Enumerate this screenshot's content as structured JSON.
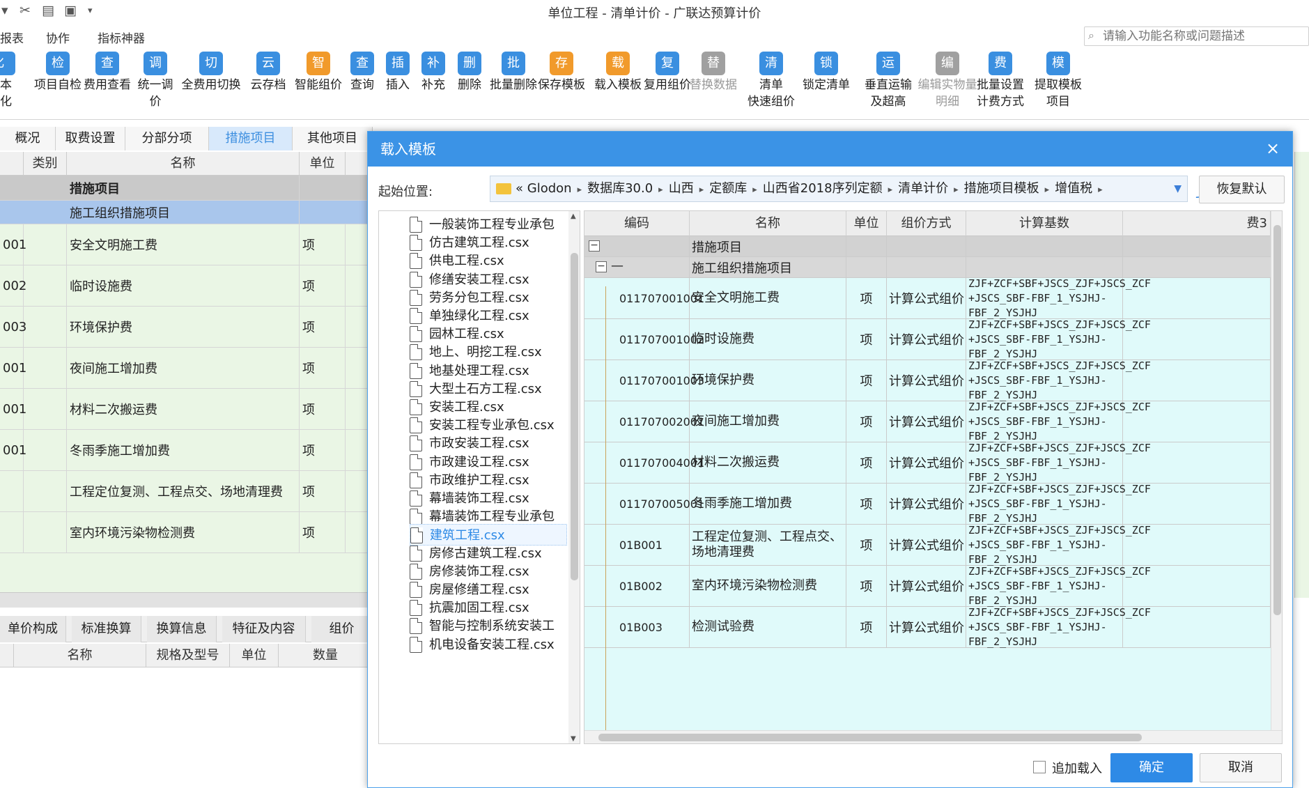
{
  "app": {
    "title": "单位工程 - 清单计价 - 广联达预算计价",
    "quick_access": [
      "▾",
      "✂",
      "▤",
      "▣",
      "▾"
    ]
  },
  "menu": [
    "报表",
    "协作",
    "指标神器"
  ],
  "search": {
    "placeholder": "请输入功能名称或问题描述"
  },
  "ribbon": [
    {
      "label": "本化",
      "icon": "partial-icon",
      "color": "#3a8fe0"
    },
    {
      "label": "项目自检",
      "icon": "check-icon",
      "color": "#3a8fe0"
    },
    {
      "label": "费用查看",
      "icon": "fee-view-icon",
      "color": "#3a8fe0"
    },
    {
      "label": "统一调价",
      "icon": "adjust-price-icon",
      "color": "#3a8fe0"
    },
    {
      "label": "全费用切换",
      "icon": "switch-icon",
      "color": "#3a8fe0"
    },
    {
      "label": "云存档",
      "icon": "cloud-icon",
      "color": "#3a8fe0"
    },
    {
      "label": "智能组价",
      "icon": "smart-price-icon",
      "color": "#f19a2b"
    },
    {
      "label": "查询",
      "icon": "query-icon",
      "color": "#3a8fe0"
    },
    {
      "label": "插入",
      "icon": "insert-icon",
      "color": "#3a8fe0"
    },
    {
      "label": "补充",
      "icon": "supplement-icon",
      "color": "#3a8fe0"
    },
    {
      "label": "删除",
      "icon": "delete-icon",
      "color": "#3a8fe0"
    },
    {
      "label": "批量删除",
      "icon": "batch-delete-icon",
      "color": "#3a8fe0"
    },
    {
      "label": "保存模板",
      "icon": "save-template-icon",
      "color": "#f19a2b"
    },
    {
      "label": "载入模板",
      "icon": "load-template-icon",
      "color": "#f19a2b"
    },
    {
      "label": "复用组价",
      "icon": "reuse-icon",
      "color": "#3a8fe0"
    },
    {
      "label": "替换数据",
      "icon": "replace-data-icon",
      "color": "#a0a0a0"
    },
    {
      "label": "清单\n快速组价",
      "icon": "quick-price-icon",
      "color": "#3a8fe0"
    },
    {
      "label": "锁定清单",
      "icon": "lock-icon",
      "color": "#3a8fe0"
    },
    {
      "label": "垂直运输\n及超高",
      "icon": "vertical-transport-icon",
      "color": "#3a8fe0"
    },
    {
      "label": "编辑实物量\n明细",
      "icon": "edit-quantity-icon",
      "color": "#a0a0a0"
    },
    {
      "label": "批量设置\n计费方式",
      "icon": "fee-method-icon",
      "color": "#3a8fe0"
    },
    {
      "label": "提取模板\n项目",
      "icon": "extract-template-icon",
      "color": "#3a8fe0"
    }
  ],
  "ribbon_glyphs": [
    "化",
    "检",
    "查",
    "调",
    "切",
    "云",
    "智",
    "查",
    "插",
    "补",
    "删",
    "批",
    "存",
    "载",
    "复",
    "替",
    "清",
    "锁",
    "运",
    "编",
    "费",
    "模"
  ],
  "left_tabs": [
    "概况",
    "取费设置",
    "分部分项",
    "措施项目",
    "其他项目"
  ],
  "left_grid": {
    "headers": [
      "",
      "类别",
      "名称",
      "单位"
    ],
    "section": "措施项目",
    "group": "施工组织措施项目",
    "rows": [
      {
        "code": "001",
        "name": "安全文明施工费",
        "unit": "项"
      },
      {
        "code": "002",
        "name": "临时设施费",
        "unit": "项"
      },
      {
        "code": "003",
        "name": "环境保护费",
        "unit": "项"
      },
      {
        "code": "001",
        "name": "夜间施工增加费",
        "unit": "项"
      },
      {
        "code": "001",
        "name": "材料二次搬运费",
        "unit": "项"
      },
      {
        "code": "001",
        "name": "冬雨季施工增加费",
        "unit": "项"
      },
      {
        "code": "",
        "name": "工程定位复测、工程点交、场地清理费",
        "unit": "项"
      },
      {
        "code": "",
        "name": "室内环境污染物检测费",
        "unit": "项"
      }
    ]
  },
  "lower_tabs": [
    "单价构成",
    "标准换算",
    "换算信息",
    "特征及内容",
    "组价"
  ],
  "lower_headers": [
    "",
    "名称",
    "规格及型号",
    "单位",
    "数量"
  ],
  "dialog": {
    "title": "载入模板",
    "close": "×",
    "start_label": "起始位置:",
    "path": [
      "«",
      "Glodon",
      "数据库30.0",
      "山西",
      "定额库",
      "山西省2018序列定额",
      "清单计价",
      "措施项目模板",
      "增值税"
    ],
    "restore": "恢复默认",
    "append_label": "追加载入",
    "ok": "确定",
    "cancel": "取消"
  },
  "files": [
    {
      "name": "一般装饰工程专业承包",
      "selected": false
    },
    {
      "name": "仿古建筑工程.csx",
      "selected": false
    },
    {
      "name": "供电工程.csx",
      "selected": false
    },
    {
      "name": "修缮安装工程.csx",
      "selected": false
    },
    {
      "name": "劳务分包工程.csx",
      "selected": false
    },
    {
      "name": "单独绿化工程.csx",
      "selected": false
    },
    {
      "name": "园林工程.csx",
      "selected": false
    },
    {
      "name": "地上、明挖工程.csx",
      "selected": false
    },
    {
      "name": "地基处理工程.csx",
      "selected": false
    },
    {
      "name": "大型土石方工程.csx",
      "selected": false
    },
    {
      "name": "安装工程.csx",
      "selected": false
    },
    {
      "name": "安装工程专业承包.csx",
      "selected": false
    },
    {
      "name": "市政安装工程.csx",
      "selected": false
    },
    {
      "name": "市政建设工程.csx",
      "selected": false
    },
    {
      "name": "市政维护工程.csx",
      "selected": false
    },
    {
      "name": "幕墙装饰工程.csx",
      "selected": false
    },
    {
      "name": "幕墙装饰工程专业承包",
      "selected": false
    },
    {
      "name": "建筑工程.csx",
      "selected": true
    },
    {
      "name": "房修古建筑工程.csx",
      "selected": false
    },
    {
      "name": "房修装饰工程.csx",
      "selected": false
    },
    {
      "name": "房屋修缮工程.csx",
      "selected": false
    },
    {
      "name": "抗震加固工程.csx",
      "selected": false
    },
    {
      "name": "智能与控制系统安装工",
      "selected": false
    },
    {
      "name": "机电设备安装工程.csx",
      "selected": false
    }
  ],
  "template_grid": {
    "headers": [
      "编码",
      "名称",
      "单位",
      "组价方式",
      "计算基数",
      "费3"
    ],
    "section": "措施项目",
    "group_code": "—",
    "group": "施工组织措施项目",
    "expand_minus": "−",
    "base_formula": "ZJF+ZCF+SBF+JSCS_ZJF+JSCS_ZCF +JSCS_SBF-FBF_1_YSJHJ- FBF_2_YSJHJ",
    "rows": [
      {
        "code": "011707001001",
        "name": "安全文明施工费",
        "unit": "项",
        "method": "计算公式组价"
      },
      {
        "code": "011707001002",
        "name": "临时设施费",
        "unit": "项",
        "method": "计算公式组价"
      },
      {
        "code": "011707001003",
        "name": "环境保护费",
        "unit": "项",
        "method": "计算公式组价"
      },
      {
        "code": "011707002001",
        "name": "夜间施工增加费",
        "unit": "项",
        "method": "计算公式组价"
      },
      {
        "code": "011707004001",
        "name": "材料二次搬运费",
        "unit": "项",
        "method": "计算公式组价"
      },
      {
        "code": "011707005001",
        "name": "冬雨季施工增加费",
        "unit": "项",
        "method": "计算公式组价"
      },
      {
        "code": "01B001",
        "name": "工程定位复测、工程点交、场地清理费",
        "unit": "项",
        "method": "计算公式组价"
      },
      {
        "code": "01B002",
        "name": "室内环境污染物检测费",
        "unit": "项",
        "method": "计算公式组价"
      },
      {
        "code": "01B003",
        "name": "检测试验费",
        "unit": "项",
        "method": "计算公式组价"
      }
    ]
  }
}
